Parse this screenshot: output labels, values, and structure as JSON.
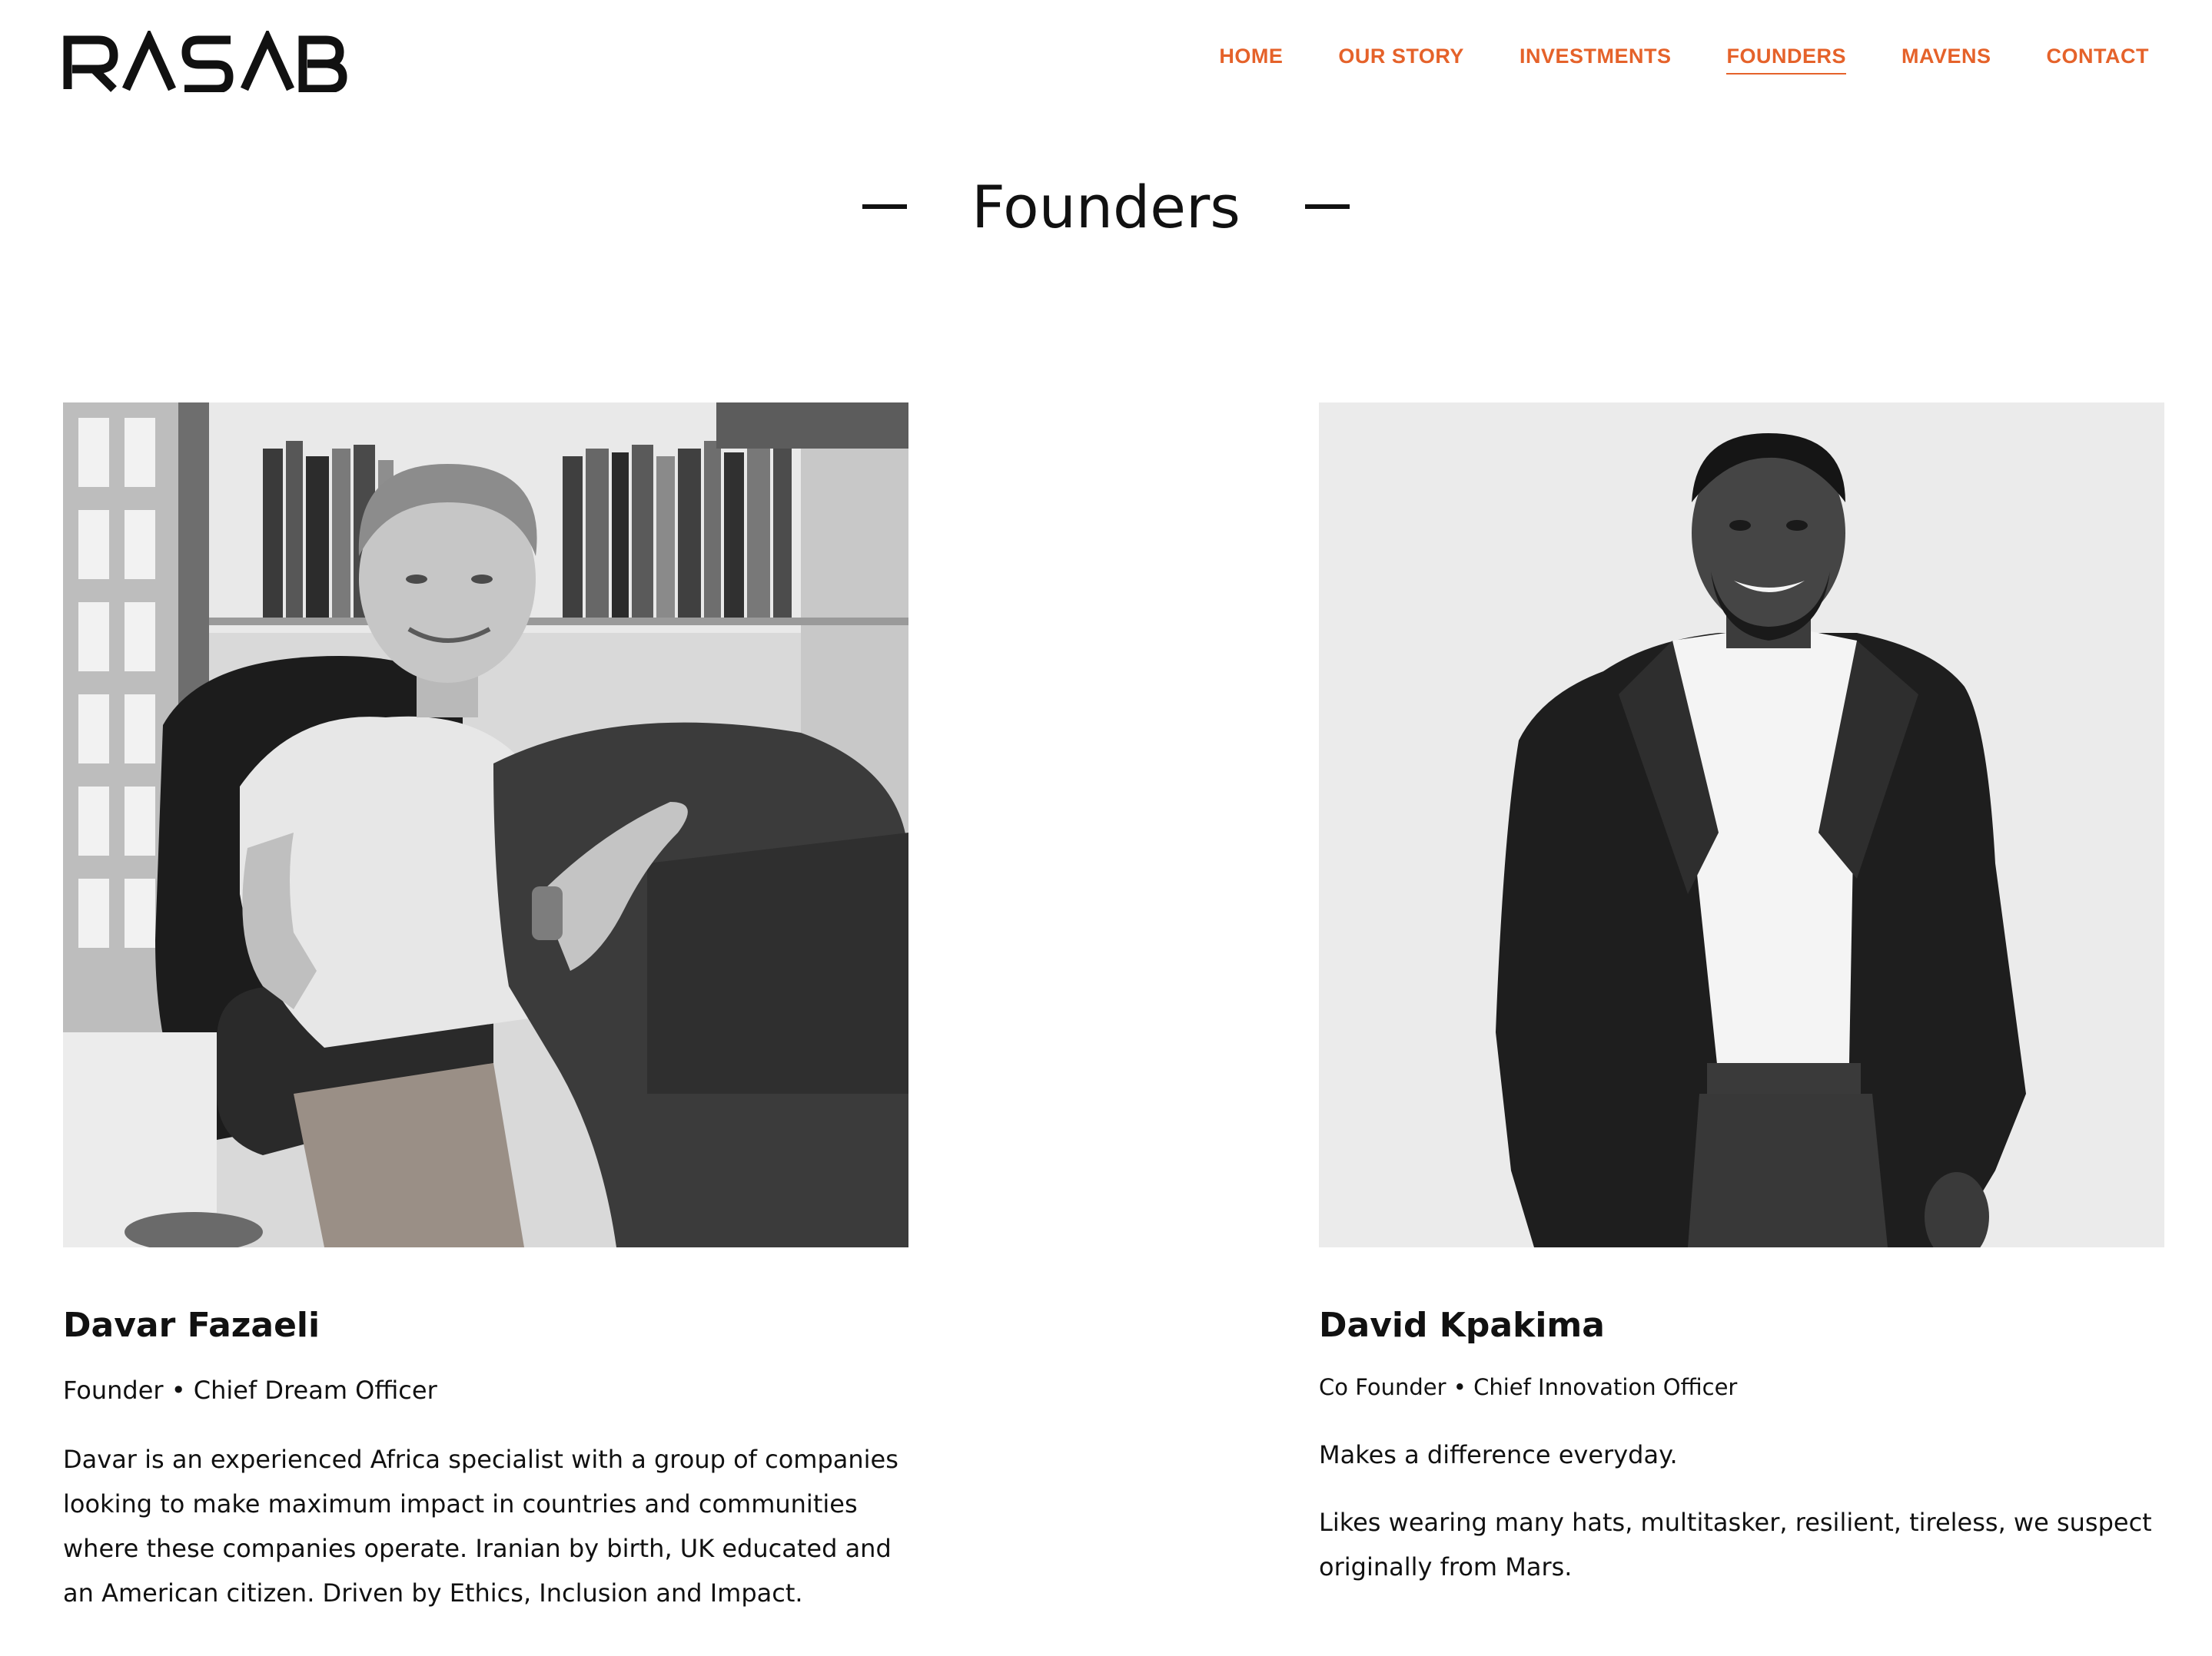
{
  "header": {
    "logo": "RASAB",
    "nav": [
      {
        "label": "HOME"
      },
      {
        "label": "OUR STORY"
      },
      {
        "label": "INVESTMENTS"
      },
      {
        "label": "FOUNDERS",
        "active": true
      },
      {
        "label": "MAVENS"
      },
      {
        "label": "CONTACT"
      }
    ]
  },
  "colors": {
    "accent": "#e5622a",
    "text": "#111111",
    "background": "#ffffff"
  },
  "main": {
    "title": "Founders",
    "founders": [
      {
        "name": "Davar Fazaeli",
        "role": "Founder • Chief Dream Officer",
        "bio": [
          "Davar is an experienced Africa specialist with a group of companies looking to make maximum impact in countries and communities where these companies operate. Iranian by birth, UK educated and an American citizen. Driven by Ethics, Inclusion and Impact."
        ]
      },
      {
        "name": "David Kpakima",
        "role": "Co Founder • Chief Innovation Officer",
        "bio": [
          "Makes a difference everyday.",
          "Likes wearing many hats, multitasker, resilient, tireless, we suspect originally from Mars."
        ]
      }
    ]
  }
}
